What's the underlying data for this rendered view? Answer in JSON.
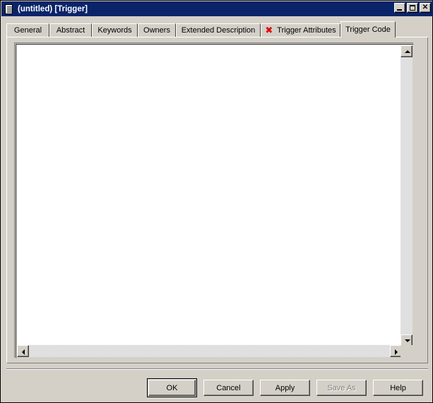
{
  "window": {
    "title": "(untitled) [Trigger]",
    "icon": "document-icon",
    "controls": {
      "minimize": "–",
      "maximize": "□",
      "close": "✕"
    },
    "colors": {
      "titlebar": "#0a246a",
      "face": "#d4d0c8",
      "error_mark": "#e00000"
    }
  },
  "tabs": [
    {
      "label": "General",
      "active": false,
      "marker": ""
    },
    {
      "label": "Abstract",
      "active": false,
      "marker": ""
    },
    {
      "label": "Keywords",
      "active": false,
      "marker": ""
    },
    {
      "label": "Owners",
      "active": false,
      "marker": ""
    },
    {
      "label": "Extended Description",
      "active": false,
      "marker": ""
    },
    {
      "label": "Trigger Attributes",
      "active": false,
      "marker": "✖"
    },
    {
      "label": "Trigger Code",
      "active": true,
      "marker": ""
    }
  ],
  "editor": {
    "name": "trigger-code-editor",
    "value": "",
    "placeholder": ""
  },
  "scrollbars": {
    "vertical": {
      "up": "▲",
      "down": "▼"
    },
    "horizontal": {
      "left": "◄",
      "right": "►"
    }
  },
  "buttons": [
    {
      "label": "OK",
      "default": true,
      "disabled": false
    },
    {
      "label": "Cancel",
      "default": false,
      "disabled": false
    },
    {
      "label": "Apply",
      "default": false,
      "disabled": false
    },
    {
      "label": "Save As",
      "default": false,
      "disabled": true
    },
    {
      "label": "Help",
      "default": false,
      "disabled": false
    }
  ]
}
